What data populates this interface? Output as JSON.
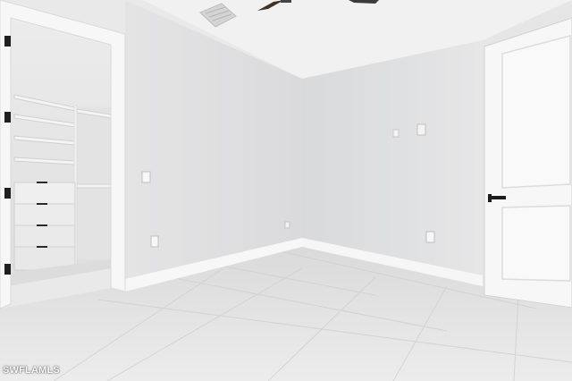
{
  "photo": {
    "subject": "empty-bedroom-with-walk-in-closet",
    "colors": {
      "ceiling": "#f3f3f3",
      "left_wall": "#e2e2e3",
      "back_wall": "#dcdddf",
      "right_wall": "#e6e6e7",
      "floor": "#e4e4e4",
      "trim": "#fbfbfb",
      "door_hardware": "#1e1e1e"
    }
  },
  "watermark": {
    "text": "SWFLAMLS"
  }
}
